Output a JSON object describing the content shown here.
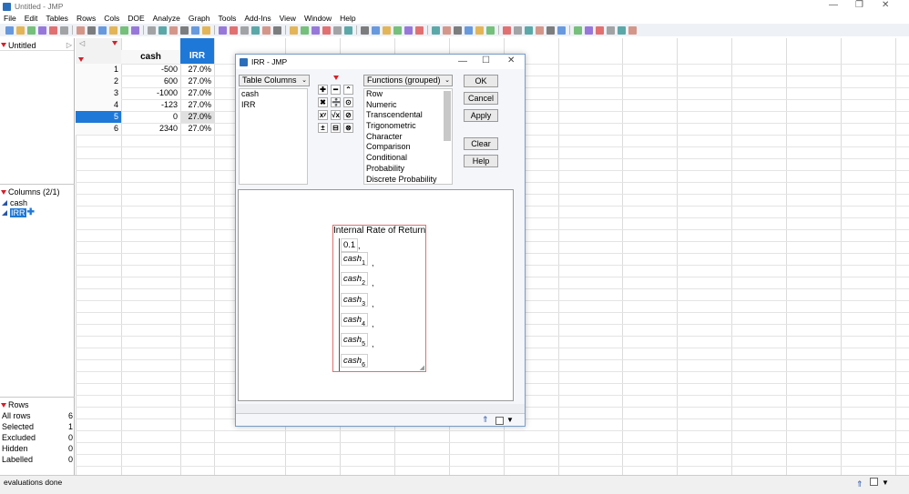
{
  "window": {
    "title": "Untitled - JMP"
  },
  "menu": [
    "File",
    "Edit",
    "Tables",
    "Rows",
    "Cols",
    "DOE",
    "Analyze",
    "Graph",
    "Tools",
    "Add-Ins",
    "View",
    "Window",
    "Help"
  ],
  "table_panel": {
    "title": "Untitled"
  },
  "columns_panel": {
    "title": "Columns (2/1)",
    "items": [
      "cash",
      "IRR"
    ]
  },
  "rows_panel": {
    "title": "Rows",
    "stats": [
      {
        "label": "All rows",
        "value": "6"
      },
      {
        "label": "Selected",
        "value": "1"
      },
      {
        "label": "Excluded",
        "value": "0"
      },
      {
        "label": "Hidden",
        "value": "0"
      },
      {
        "label": "Labelled",
        "value": "0"
      }
    ]
  },
  "grid": {
    "headers": [
      "cash",
      "IRR"
    ],
    "rows": [
      {
        "n": "1",
        "cash": "-500",
        "irr": "27.0%"
      },
      {
        "n": "2",
        "cash": "600",
        "irr": "27.0%"
      },
      {
        "n": "3",
        "cash": "-1000",
        "irr": "27.0%"
      },
      {
        "n": "4",
        "cash": "-123",
        "irr": "27.0%"
      },
      {
        "n": "5",
        "cash": "0",
        "irr": "27.0%"
      },
      {
        "n": "6",
        "cash": "2340",
        "irr": "27.0%"
      }
    ],
    "selected_row": "5"
  },
  "dialog": {
    "title": "IRR - JMP",
    "table_columns_label": "Table Columns",
    "table_columns": [
      "cash",
      "IRR"
    ],
    "functions_label": "Functions (grouped)",
    "functions": [
      "Row",
      "Numeric",
      "Transcendental",
      "Trigonometric",
      "Character",
      "Comparison",
      "Conditional",
      "Probability",
      "Discrete Probability"
    ],
    "buttons": {
      "ok": "OK",
      "cancel": "Cancel",
      "apply": "Apply",
      "clear": "Clear",
      "help": "Help"
    },
    "formula": {
      "name": "Internal Rate of Return",
      "guess": "0.1",
      "args": [
        {
          "v": "cash",
          "s": "1"
        },
        {
          "v": "cash",
          "s": "2"
        },
        {
          "v": "cash",
          "s": "3"
        },
        {
          "v": "cash",
          "s": "4"
        },
        {
          "v": "cash",
          "s": "5"
        },
        {
          "v": "cash",
          "s": "6"
        }
      ]
    }
  },
  "status": {
    "text": "evaluations done"
  },
  "colors": {
    "selection": "#1e78d7",
    "accent": "#d4202a",
    "column_icon": "#2a56a8"
  }
}
